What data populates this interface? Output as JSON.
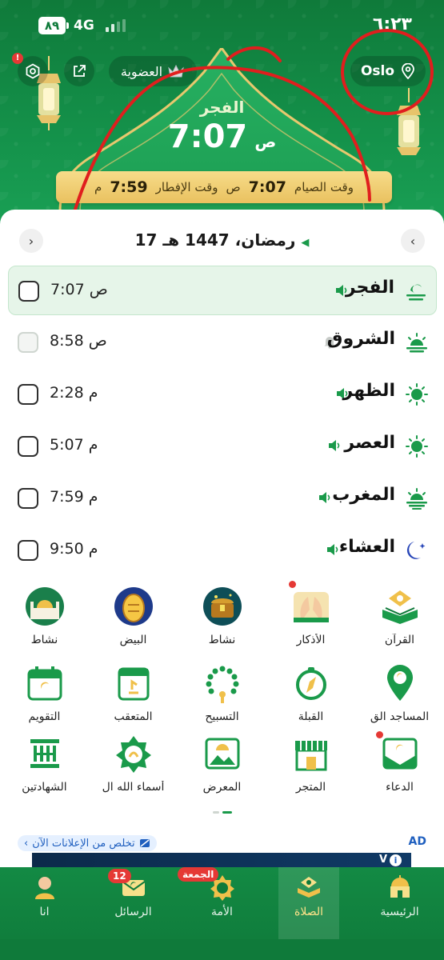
{
  "colors": {
    "primary_green": "#0f7a3a",
    "accent_green": "#1aa256",
    "gold": "#e9c15f",
    "badge_red": "#e53935",
    "active_row_bg": "#e6f5e9",
    "ad_blue": "#1f5fbf"
  },
  "status_bar": {
    "battery": "٨٩",
    "network": "4G",
    "time": "٦:٢٣"
  },
  "header": {
    "membership_label": "العضوية",
    "location_label": "Oslo",
    "current_prayer_name": "الفجر",
    "current_prayer_time": "7:07",
    "current_prayer_suffix": "ص",
    "fasting": {
      "suhoor_label": "وقت الصيام",
      "suhoor_time": "7:07",
      "suhoor_suffix": "ص",
      "iftar_label": "وقت الإفطار",
      "iftar_time": "7:59",
      "iftar_suffix": "م"
    }
  },
  "date": {
    "hijri": "17 رمضان، 1447 هـ"
  },
  "prayers": [
    {
      "name": "الفجر",
      "time": "7:07 ص",
      "icon": "fajr-icon",
      "sound": "speaker-on-icon"
    },
    {
      "name": "الشروق",
      "time": "8:58 ص",
      "icon": "sunrise-icon",
      "sound": "bell-icon"
    },
    {
      "name": "الظهر",
      "time": "2:28 م",
      "icon": "sun-icon",
      "sound": "speaker-on-icon"
    },
    {
      "name": "العصر",
      "time": "5:07 م",
      "icon": "sun-icon",
      "sound": "speaker-on-icon"
    },
    {
      "name": "المغرب",
      "time": "7:59 م",
      "icon": "sunset-icon",
      "sound": "speaker-on-icon"
    },
    {
      "name": "العشاء",
      "time": "9:50 م",
      "icon": "moon-icon",
      "sound": "speaker-on-icon"
    }
  ],
  "features": [
    {
      "label": "القرآن",
      "icon": "quran-icon"
    },
    {
      "label": "الأذكار",
      "icon": "dua-hands-icon"
    },
    {
      "label": "نشاط",
      "icon": "treasure-chest-icon"
    },
    {
      "label": "البيض",
      "icon": "golden-egg-icon"
    },
    {
      "label": "نشاط",
      "icon": "mosque-icon"
    },
    {
      "label": "المساجد الق",
      "icon": "map-pin-icon"
    },
    {
      "label": "القبلة",
      "icon": "compass-icon"
    },
    {
      "label": "التسبيح",
      "icon": "prayer-beads-icon"
    },
    {
      "label": "المتعقب",
      "icon": "tracker-icon"
    },
    {
      "label": "التقويم",
      "icon": "calendar-icon"
    },
    {
      "label": "الدعاء",
      "icon": "dua-envelope-icon"
    },
    {
      "label": "المتجر",
      "icon": "store-icon"
    },
    {
      "label": "المعرض",
      "icon": "gallery-icon"
    },
    {
      "label": "أسماء الله ال",
      "icon": "names-of-allah-icon"
    },
    {
      "label": "الشهادتين",
      "icon": "shahada-icon"
    }
  ],
  "ad": {
    "remove_ads_label": "تخلص من الإعلانات الآن",
    "ad_label": "AD",
    "banner_text": "V"
  },
  "bottom_nav": [
    {
      "label": "الرئيسية",
      "icon": "home-mosque-icon"
    },
    {
      "label": "الصلاة",
      "icon": "prayer-quran-icon"
    },
    {
      "label": "الأمة",
      "icon": "ummah-icon",
      "badge": "الجمعة"
    },
    {
      "label": "الرسائل",
      "icon": "messages-icon",
      "badge": "12"
    },
    {
      "label": "انا",
      "icon": "profile-icon"
    }
  ]
}
